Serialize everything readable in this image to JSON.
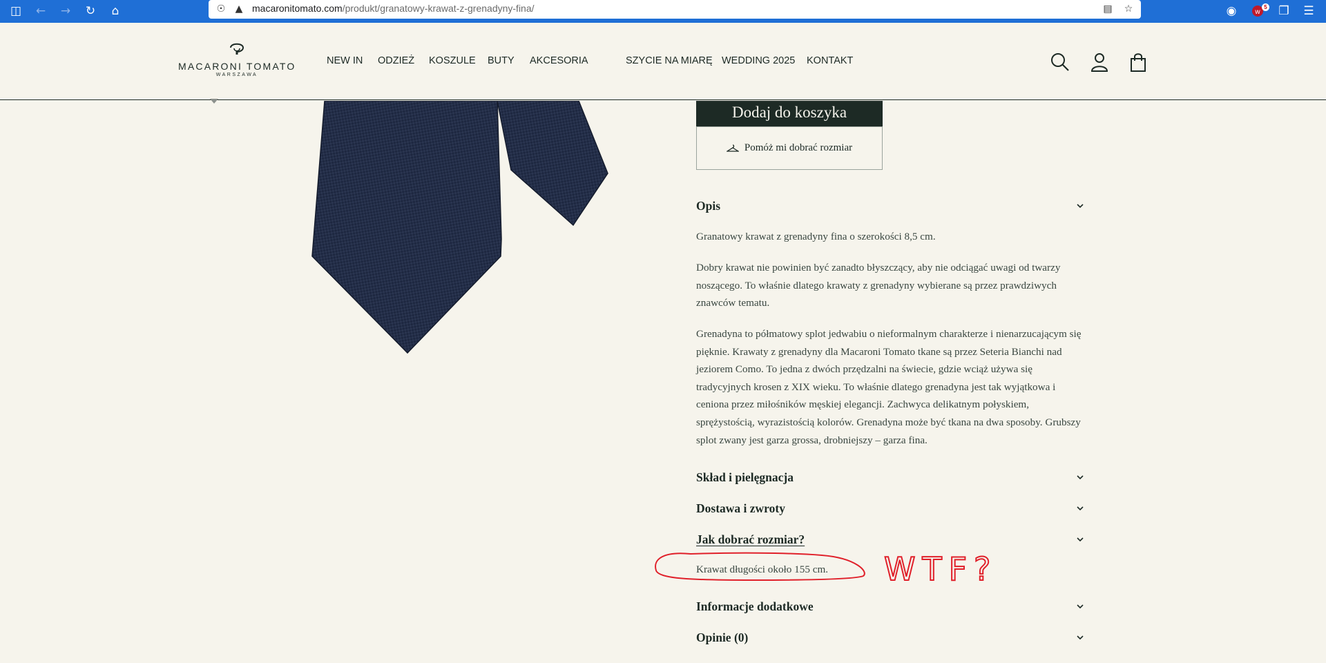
{
  "browser": {
    "url_domain": "macaronitomato.com",
    "url_path": "/produkt/granatowy-krawat-z-grenadyny-fina/",
    "extension_badge": "5"
  },
  "header": {
    "logo": {
      "name": "MACARONI TOMATO",
      "sub": "WARSZAWA"
    },
    "menu": [
      "NEW IN",
      "ODZIEŻ",
      "KOSZULE",
      "BUTY",
      "AKCESORIA",
      "SZYCIE NA MIARĘ",
      "WEDDING 2025",
      "KONTAKT"
    ]
  },
  "product": {
    "add_to_cart": "Dodaj do koszyka",
    "size_help": "Pomóż mi dobrać rozmiar"
  },
  "accordion": {
    "opis": {
      "title": "Opis",
      "paragraphs": [
        "Granatowy krawat z grenadyny fina o szerokości 8,5 cm.",
        "Dobry krawat nie powinien być zanadto błyszczący, aby nie odciągać uwagi od twarzy noszącego. To właśnie dlatego krawaty z grenadyny wybierane są przez prawdziwych znawców tematu.",
        "Grenadyna to półmatowy splot jedwabiu o nieformalnym charakterze i nienarzucającym się pięknie. Krawaty z grenadyny dla Macaroni Tomato tkane są przez Seteria Bianchi nad jeziorem Como. To jedna z dwóch przędzalni na świecie, gdzie wciąż używa się tradycyjnych krosen z XIX wieku. To właśnie dlatego grenadyna jest tak wyjątkowa i ceniona przez miłośników męskiej elegancji. Zachwyca delikatnym połyskiem, sprężystością, wyrazistością kolorów. Grenadyna może być tkana na dwa sposoby. Grubszy splot zwany jest garza grossa, drobniejszy – garza fina."
      ]
    },
    "sklad": {
      "title": "Skład i pielęgnacja"
    },
    "dostawa": {
      "title": "Dostawa i zwroty"
    },
    "rozmiar": {
      "title": "Jak dobrać rozmiar?",
      "body": "Krawat długości około 155 cm."
    },
    "info": {
      "title": "Informacje dodatkowe"
    },
    "opinie": {
      "title": "Opinie (0)"
    }
  },
  "annotation": {
    "text": "WTF?",
    "color": "#e0202a"
  },
  "colors": {
    "background": "#f6f4ec",
    "brand_dark": "#1d2a25",
    "browser_blue": "#1f6fd6",
    "tie_navy": "#26314a"
  }
}
